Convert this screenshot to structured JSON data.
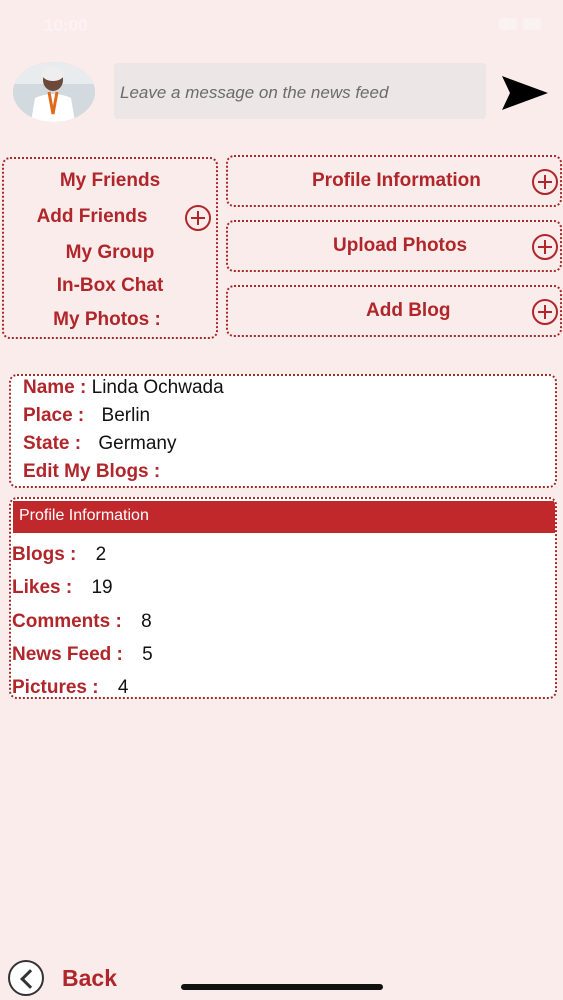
{
  "status_bar": {
    "time": "10:00"
  },
  "composer": {
    "placeholder": "Leave a message on the news feed",
    "send_icon": "send-arrow-icon"
  },
  "menu": {
    "items": [
      {
        "label": "My Friends"
      },
      {
        "label": "Add  Friends"
      },
      {
        "label": "My Group"
      },
      {
        "label": "In-Box Chat"
      },
      {
        "label": "My Photos :"
      }
    ]
  },
  "actions": [
    {
      "label": "Profile Information"
    },
    {
      "label": "Upload Photos"
    },
    {
      "label": "Add Blog"
    }
  ],
  "profile": {
    "name_label": "Name :",
    "name": "Linda Ochwada",
    "place_label": "Place :",
    "place": "Berlin",
    "state_label": "State :",
    "state": "Germany",
    "edit_blogs_label": "Edit My Blogs :"
  },
  "stats": {
    "header": "Profile Information",
    "rows": [
      {
        "label": "Blogs :",
        "value": "2"
      },
      {
        "label": "Likes :",
        "value": "19"
      },
      {
        "label": "Comments :",
        "value": "8"
      },
      {
        "label": "News Feed :",
        "value": "5"
      },
      {
        "label": "Pictures :",
        "value": "4"
      }
    ]
  },
  "footer": {
    "back_label": "Back"
  },
  "colors": {
    "accent": "#b0262a",
    "header_bar": "#c0282b",
    "background": "#fbecec"
  }
}
